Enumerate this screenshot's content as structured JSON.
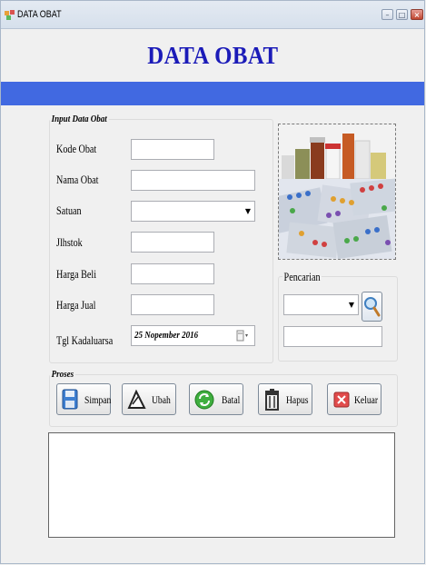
{
  "window": {
    "title": "DATA OBAT"
  },
  "header": {
    "title": "DATA OBAT"
  },
  "input_group": {
    "label": "Input Data Obat",
    "fields": {
      "kode_obat": {
        "label": "Kode Obat",
        "value": ""
      },
      "nama_obat": {
        "label": "Nama Obat",
        "value": ""
      },
      "satuan": {
        "label": "Satuan",
        "value": ""
      },
      "jlhstok": {
        "label": "Jlhstok",
        "value": ""
      },
      "harga_beli": {
        "label": "Harga Beli",
        "value": ""
      },
      "harga_jual": {
        "label": "Harga Jual",
        "value": ""
      },
      "tgl_kadaluarsa": {
        "label": "Tgl Kadaluarsa",
        "value": "25 Nopember 2016"
      }
    }
  },
  "search_group": {
    "label": "Pencarian",
    "category_value": "",
    "keyword_value": ""
  },
  "proses_group": {
    "label": "Proses",
    "buttons": {
      "simpan": "Simpan",
      "ubah": "Ubah",
      "batal": "Batal",
      "hapus": "Hapus",
      "keluar": "Keluar"
    }
  },
  "icons": {
    "app": "app-icon",
    "simpan": "floppy-disk-icon",
    "ubah": "edit-icon",
    "batal": "refresh-icon",
    "hapus": "trash-icon",
    "keluar": "exit-icon",
    "search": "magnifier-icon",
    "date": "calendar-icon"
  },
  "colors": {
    "banner_text": "#1b1bb8",
    "accent_bar": "#4169e1"
  }
}
